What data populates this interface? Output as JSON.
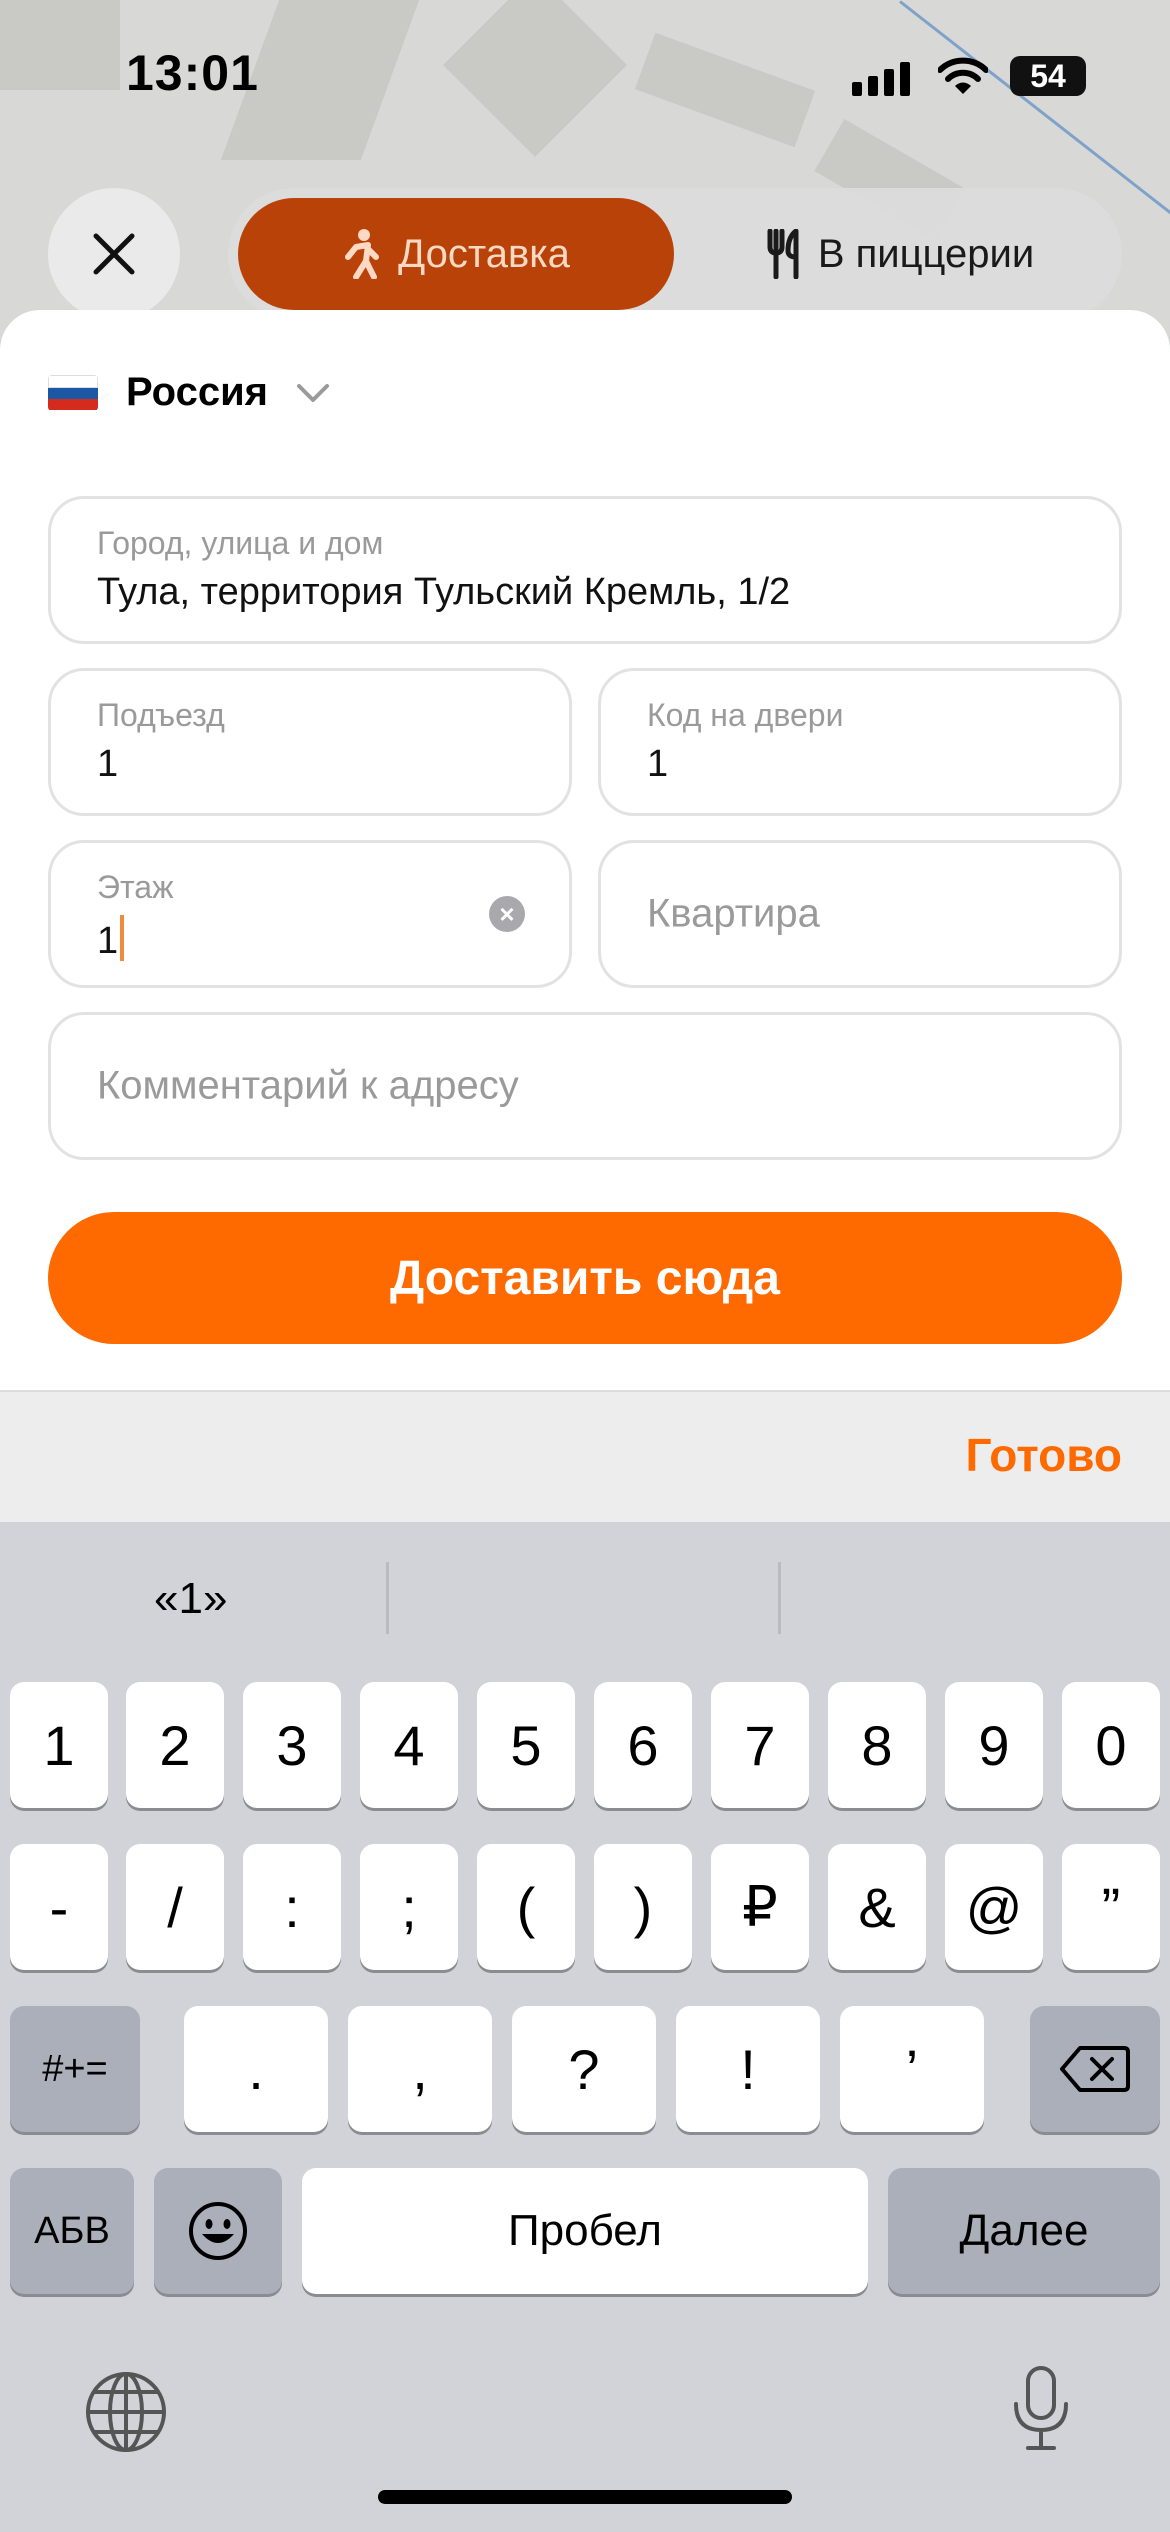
{
  "status": {
    "time": "13:01",
    "battery": "54"
  },
  "mode": {
    "active_label": "Доставка",
    "inactive_label": "В пиццерии"
  },
  "country": {
    "name": "Россия",
    "flag_colors": [
      "#ffffff",
      "#1c57a5",
      "#d52b1e"
    ]
  },
  "form": {
    "address": {
      "label": "Город, улица и дом",
      "value": "Тула, территория Тульский Кремль, 1/2"
    },
    "entrance": {
      "label": "Подъезд",
      "value": "1"
    },
    "door_code": {
      "label": "Код на двери",
      "value": "1"
    },
    "floor": {
      "label": "Этаж",
      "value": "1"
    },
    "apartment": {
      "placeholder": "Квартира"
    },
    "comment": {
      "placeholder": "Комментарий к адресу"
    }
  },
  "deliver_button": "Доставить сюда",
  "accessory": {
    "done": "Готово"
  },
  "keyboard": {
    "suggestion": "«1»",
    "row1": [
      "1",
      "2",
      "3",
      "4",
      "5",
      "6",
      "7",
      "8",
      "9",
      "0"
    ],
    "row2": [
      "-",
      "/",
      ":",
      ";",
      "(",
      ")",
      "₽",
      "&",
      "@",
      "”"
    ],
    "row3_mode": "#+=",
    "row3": [
      ".",
      ",",
      "?",
      "!",
      "’"
    ],
    "abc": "АБВ",
    "space": "Пробел",
    "next": "Далее"
  },
  "colors": {
    "accent": "#ff6a00",
    "active_mode": "#b84208"
  },
  "icons": [
    "close-icon",
    "walking-person-icon",
    "fork-knife-icon",
    "chevron-down-icon",
    "clear-icon",
    "backspace-icon",
    "emoji-icon",
    "globe-icon",
    "mic-icon",
    "signal-icon",
    "wifi-icon"
  ]
}
